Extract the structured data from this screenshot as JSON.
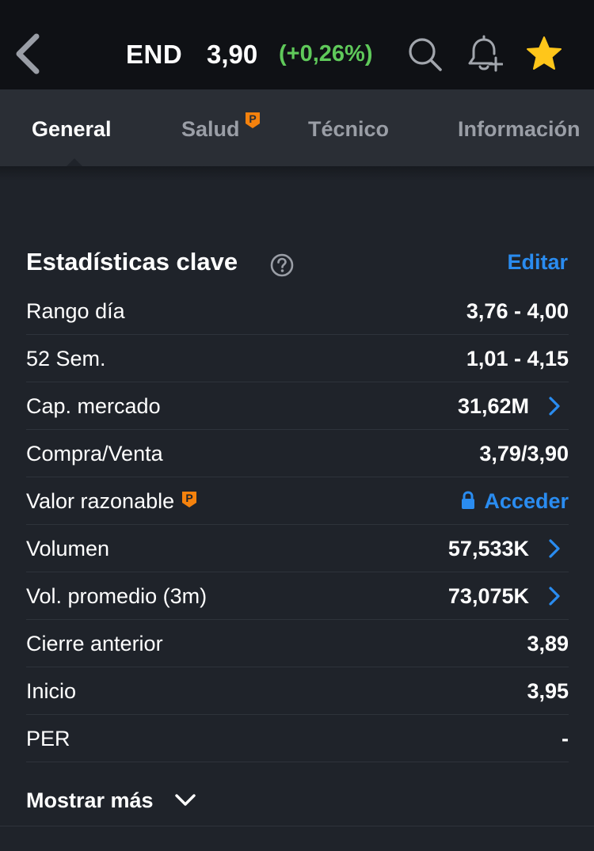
{
  "header": {
    "ticker": "END",
    "price": "3,90",
    "change": "(+0,26%)",
    "change_color": "#5fc95a",
    "icons": [
      "back-arrow-icon",
      "search-icon",
      "bell-plus-icon",
      "star-icon"
    ]
  },
  "tabs": [
    {
      "label": "General",
      "active": true
    },
    {
      "label": "Salud",
      "active": false,
      "badge": "P"
    },
    {
      "label": "Técnico",
      "active": false
    },
    {
      "label": "Información",
      "active": false
    }
  ],
  "stats": {
    "title": "Estadísticas clave",
    "edit_label": "Editar",
    "rows": [
      {
        "label": "Rango día",
        "value": "3,76 - 4,00"
      },
      {
        "label": "52 Sem.",
        "value": "1,01 - 4,15"
      },
      {
        "label": "Cap. mercado",
        "value": "31,62M"
      },
      {
        "label": "Compra/Venta",
        "value": "3,79/3,90"
      },
      {
        "label": "Valor razonable",
        "value": "Acceder"
      },
      {
        "label": "Volumen",
        "value": "57,533K"
      },
      {
        "label": "Vol. promedio (3m)",
        "value": "73,075K"
      },
      {
        "label": "Cierre anterior",
        "value": "3,89"
      },
      {
        "label": "Inicio",
        "value": "3,95"
      },
      {
        "label": "PER",
        "value": "-"
      }
    ],
    "show_more": "Mostrar más"
  },
  "colors": {
    "accent": "#2a8cf0",
    "premium": "#f5820d",
    "star": "#ffc61a"
  }
}
